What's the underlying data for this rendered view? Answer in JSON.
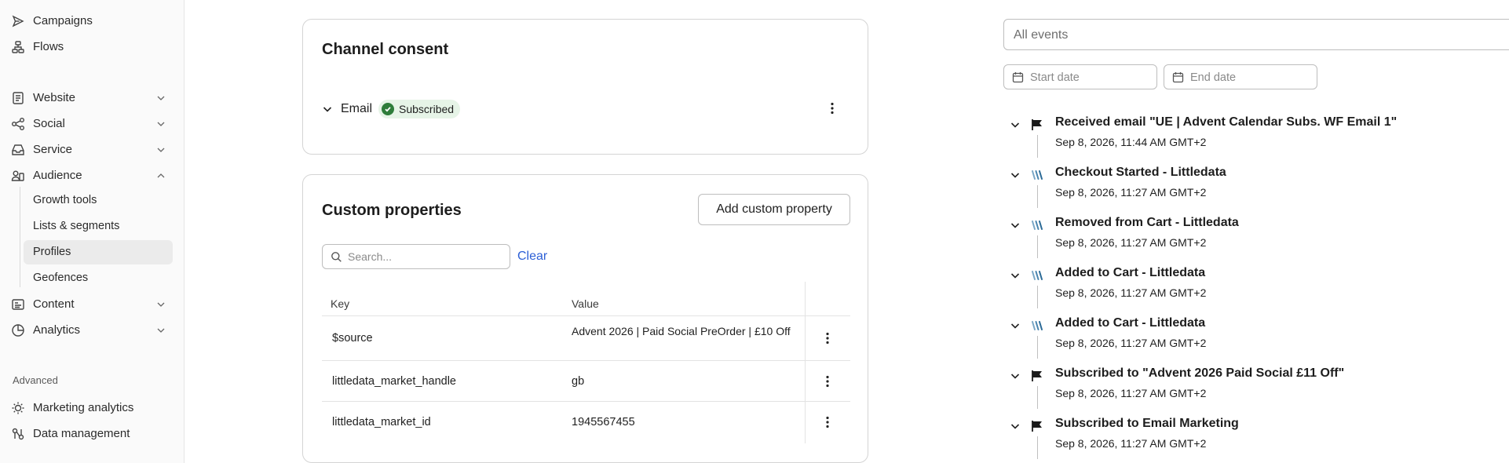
{
  "sidebar": {
    "top_items": [
      {
        "label": "Campaigns",
        "icon": "send-icon"
      },
      {
        "label": "Flows",
        "icon": "flow-icon"
      }
    ],
    "groups": [
      {
        "label": "Website",
        "icon": "page-icon",
        "expanded": false
      },
      {
        "label": "Social",
        "icon": "share-icon",
        "expanded": false
      },
      {
        "label": "Service",
        "icon": "inbox-icon",
        "expanded": false
      },
      {
        "label": "Audience",
        "icon": "users-icon",
        "expanded": true
      },
      {
        "label": "Content",
        "icon": "image-icon",
        "expanded": false
      },
      {
        "label": "Analytics",
        "icon": "chart-icon",
        "expanded": false
      }
    ],
    "audience_sub_items": [
      {
        "label": "Growth tools",
        "active": false
      },
      {
        "label": "Lists & segments",
        "active": false
      },
      {
        "label": "Profiles",
        "active": true
      },
      {
        "label": "Geofences",
        "active": false
      }
    ],
    "advanced_label": "Advanced",
    "advanced_items": [
      {
        "label": "Marketing analytics",
        "icon": "bulb-icon"
      },
      {
        "label": "Data management",
        "icon": "data-icon"
      }
    ]
  },
  "consent": {
    "title": "Channel consent",
    "channel_label": "Email",
    "status_badge": "Subscribed"
  },
  "custom_properties": {
    "title": "Custom properties",
    "add_button": "Add custom property",
    "search_placeholder": "Search...",
    "clear_link": "Clear",
    "columns": [
      "Key",
      "Value"
    ],
    "rows": [
      {
        "key": "$source",
        "value": "Advent 2026 | Paid Social PreOrder | £10 Off"
      },
      {
        "key": "littledata_market_handle",
        "value": "gb"
      },
      {
        "key": "littledata_market_id",
        "value": "1945567455"
      }
    ]
  },
  "events_panel": {
    "filter_placeholder": "All events",
    "start_date_placeholder": "Start date",
    "end_date_placeholder": "End date",
    "events": [
      {
        "title": "Received email \"UE | Advent Calendar Subs. WF Email 1\"",
        "time": "Sep 8, 2026, 11:44 AM GMT+2",
        "icon": "flag-icon"
      },
      {
        "title": "Checkout Started - Littledata",
        "time": "Sep 8, 2026, 11:27 AM GMT+2",
        "icon": "littledata-icon"
      },
      {
        "title": "Removed from Cart - Littledata",
        "time": "Sep 8, 2026, 11:27 AM GMT+2",
        "icon": "littledata-icon"
      },
      {
        "title": "Added to Cart - Littledata",
        "time": "Sep 8, 2026, 11:27 AM GMT+2",
        "icon": "littledata-icon"
      },
      {
        "title": "Added to Cart - Littledata",
        "time": "Sep 8, 2026, 11:27 AM GMT+2",
        "icon": "littledata-icon"
      },
      {
        "title": "Subscribed to \"Advent 2026 Paid Social £11 Off\"",
        "time": "Sep 8, 2026, 11:27 AM GMT+2",
        "icon": "flag-icon"
      },
      {
        "title": "Subscribed to Email Marketing",
        "time": "Sep 8, 2026, 11:27 AM GMT+2",
        "icon": "flag-icon"
      }
    ]
  },
  "colors": {
    "link": "#2c5fd6",
    "success": "#2e7d3a",
    "success_bg": "#e6f4e7",
    "active_nav_bg": "#ebebeb"
  }
}
